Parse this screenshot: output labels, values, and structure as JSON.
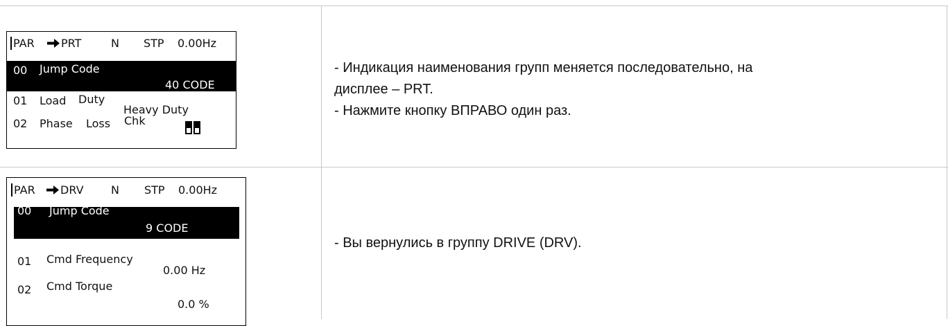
{
  "rows": [
    {
      "lcd": {
        "mode": "PAR",
        "group": "PRT",
        "dir": "N",
        "state": "STP",
        "freq": "0.00Hz",
        "line1": {
          "num": "00",
          "name": "Jump Code",
          "value": "40 CODE"
        },
        "line2": {
          "num": "01",
          "name_a": "Load",
          "name_b": "Duty",
          "value": "Heavy Duty"
        },
        "line3": {
          "num": "02",
          "name_a": "Phase",
          "name_b": "Loss",
          "name_c": "Chk"
        }
      },
      "description": [
        " - Индикация наименования групп меняется последовательно, на",
        "дисплее – PRT.",
        " - Нажмите кнопку ВПРАВО один раз."
      ]
    },
    {
      "lcd": {
        "mode": "PAR",
        "group": "DRV",
        "dir": "N",
        "state": "STP",
        "freq": "0.00Hz",
        "line1": {
          "num": "00",
          "name": "Jump Code",
          "value": "9 CODE"
        },
        "line2": {
          "num": "01",
          "name": "Cmd Frequency",
          "value": "0.00 Hz"
        },
        "line3": {
          "num": "02",
          "name": "Cmd Torque",
          "value": "0.0 %"
        }
      },
      "description": [
        "- Вы вернулись в группу DRIVE (DRV)."
      ]
    }
  ]
}
